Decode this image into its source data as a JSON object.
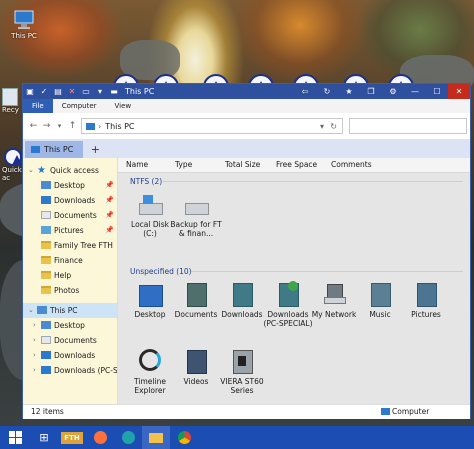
{
  "desktop": {
    "icons": [
      {
        "label": "This PC"
      }
    ],
    "partial_labels": [
      "Recy",
      "Quick",
      "ac"
    ]
  },
  "window": {
    "title": "This PC",
    "ribbon_tabs": [
      "File",
      "Computer",
      "View"
    ],
    "address": "This PC",
    "search_placeholder": "",
    "tab_label": "This PC",
    "new_tab": "+",
    "colors": {
      "titlebar": "#2f4f9f",
      "accent": "#2f5fb3",
      "sidebar_bg": "#fbf7d8",
      "selection": "#cde4f7"
    }
  },
  "sidebar": {
    "items": [
      {
        "label": "Quick access",
        "icon": "star-icon",
        "pinned": false
      },
      {
        "label": "Desktop",
        "icon": "desktop-folder-icon",
        "pinned": true
      },
      {
        "label": "Downloads",
        "icon": "downloads-folder-icon",
        "pinned": true
      },
      {
        "label": "Documents",
        "icon": "documents-folder-icon",
        "pinned": true
      },
      {
        "label": "Pictures",
        "icon": "pictures-folder-icon",
        "pinned": true
      },
      {
        "label": "Family Tree FTH",
        "icon": "folder-icon",
        "pinned": false
      },
      {
        "label": "Finance",
        "icon": "folder-icon",
        "pinned": false
      },
      {
        "label": "Help",
        "icon": "folder-icon",
        "pinned": false
      },
      {
        "label": "Photos",
        "icon": "folder-icon",
        "pinned": false
      },
      {
        "label": "This PC",
        "icon": "computer-icon",
        "pinned": false
      },
      {
        "label": "Desktop",
        "icon": "desktop-folder-icon",
        "pinned": false
      },
      {
        "label": "Documents",
        "icon": "documents-folder-icon",
        "pinned": false
      },
      {
        "label": "Downloads",
        "icon": "downloads-folder-icon",
        "pinned": false
      },
      {
        "label": "Downloads (PC-S",
        "icon": "downloads-folder-icon",
        "pinned": false
      }
    ]
  },
  "columns": [
    "Name",
    "Type",
    "Total Size",
    "Free Space",
    "Comments"
  ],
  "groups": [
    {
      "title": "NTFS (2)",
      "items": [
        "Local Disk (C:)",
        "Backup for FT & finan..."
      ]
    },
    {
      "title": "Unspecified (10)",
      "items": [
        "Desktop",
        "Documents",
        "Downloads",
        "Downloads (PC-SPECIAL)",
        "My Network",
        "Music",
        "Pictures",
        "Timeline Explorer",
        "Videos",
        "VIERA ST60 Series"
      ]
    }
  ],
  "status": {
    "item_count": "12 items",
    "location": "Computer"
  },
  "taskbar": {
    "items": [
      "windows-start-icon",
      "task-view-icon",
      "FTH",
      "firefox-icon",
      "edge-icon",
      "file-explorer-icon",
      "chrome-icon"
    ]
  }
}
